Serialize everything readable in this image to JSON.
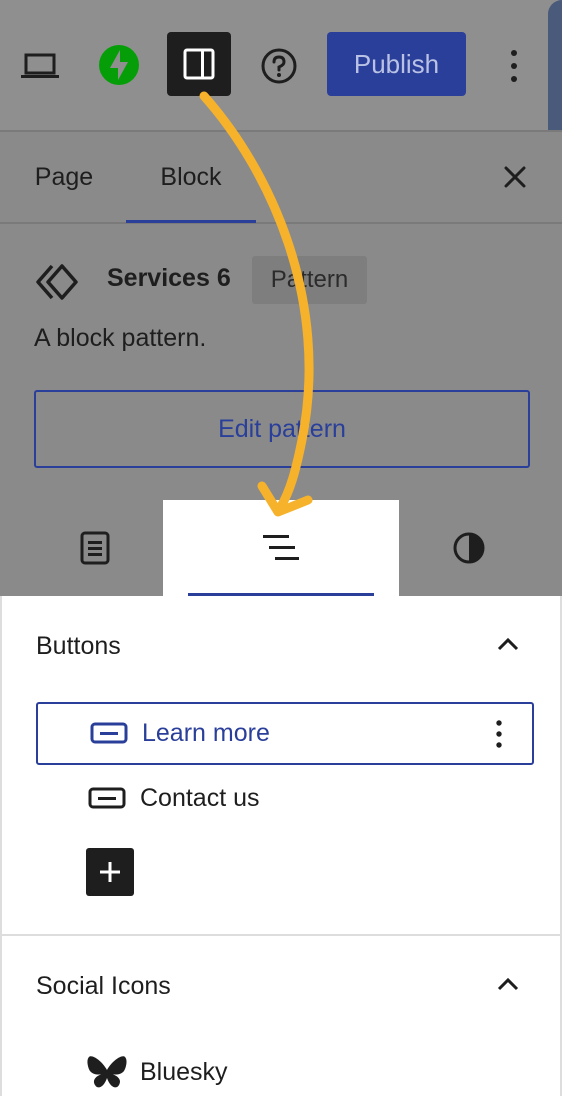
{
  "toolbar": {
    "device_icon": "laptop-icon",
    "jetpack_icon": "jetpack-bolt-icon",
    "sidebar_icon": "sidebar-toggle-icon",
    "help_icon": "help-circle-icon",
    "publish_label": "Publish",
    "more_icon": "more-vertical-icon"
  },
  "sidebar": {
    "tabs": [
      {
        "label": "Page"
      },
      {
        "label": "Block"
      }
    ],
    "close_icon": "close-icon"
  },
  "block_card": {
    "title": "Services 6",
    "badge": "Pattern",
    "description": "A block pattern.",
    "edit_label": "Edit pattern"
  },
  "subtabs": [
    "settings-icon",
    "list-view-icon",
    "styles-icon"
  ],
  "list_view": {
    "groups": [
      {
        "title": "Buttons",
        "items": [
          {
            "label": "Learn more",
            "selected": true
          },
          {
            "label": "Contact us",
            "selected": false
          }
        ]
      },
      {
        "title": "Social Icons",
        "items": [
          {
            "label": "Bluesky"
          }
        ]
      }
    ]
  },
  "colors": {
    "accent": "#2a3f9a",
    "annotation_arrow": "#f6b22b",
    "jetpack_green": "#069e08"
  }
}
